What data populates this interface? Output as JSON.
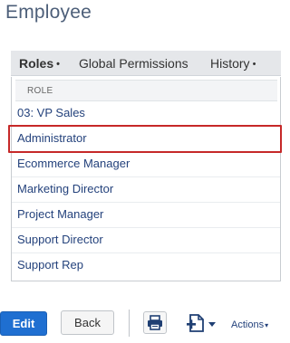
{
  "page": {
    "title": "Employee"
  },
  "tabs": [
    {
      "label": "Roles",
      "active": true,
      "dot": "•"
    },
    {
      "label": "Global Permissions",
      "active": false
    },
    {
      "label": "History",
      "active": false,
      "dot": "•"
    }
  ],
  "list": {
    "header": "ROLE",
    "rows": [
      "03: VP Sales",
      "Administrator",
      "Ecommerce Manager",
      "Marketing Director",
      "Project Manager",
      "Support Director",
      "Support Rep"
    ],
    "highlighted_row": "Administrator"
  },
  "toolbar": {
    "edit_label": "Edit",
    "back_label": "Back",
    "actions_label": "Actions",
    "actions_caret": "▾",
    "print_icon": "printer-icon",
    "new_window_icon": "new-record-icon"
  },
  "colors": {
    "title": "#4d5f79",
    "link": "#24427c",
    "primary": "#1f6fd1",
    "highlight": "#c62828"
  }
}
